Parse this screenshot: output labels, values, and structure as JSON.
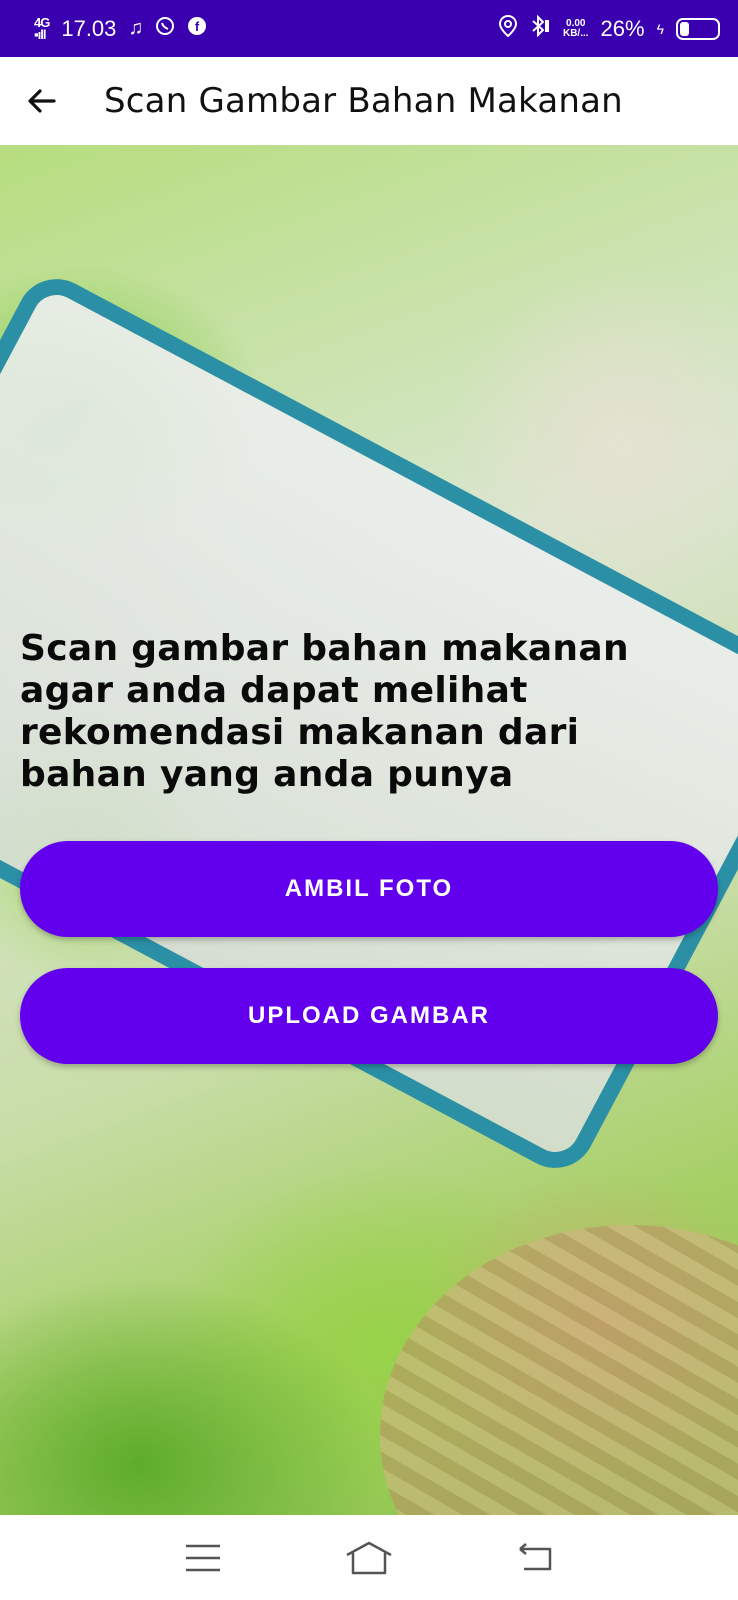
{
  "status_bar": {
    "network": "4G",
    "time": "17.03",
    "music_icon": "music-note-icon",
    "whatsapp_icon": "whatsapp-icon",
    "facebook_icon": "facebook-icon",
    "location_icon": "location-icon",
    "bluetooth_icon": "bluetooth-icon",
    "net_speed_value": "0.00",
    "net_speed_unit": "KB/...",
    "battery_percent": "26%",
    "battery_level": 0.26
  },
  "app_bar": {
    "back_icon": "arrow-back-icon",
    "title": "Scan Gambar Bahan Makanan"
  },
  "main": {
    "description": "Scan gambar bahan makanan agar anda dapat melihat rekomendasi makanan dari bahan yang anda punya",
    "take_photo_label": "AMBIL FOTO",
    "upload_label": "UPLOAD GAMBAR"
  },
  "nav_bar": {
    "menu_icon": "menu-icon",
    "home_icon": "home-icon",
    "back_icon": "back-nav-icon"
  },
  "colors": {
    "status_bar": "#3a00b0",
    "accent": "#6200ee",
    "app_bar": "#ffffff"
  }
}
